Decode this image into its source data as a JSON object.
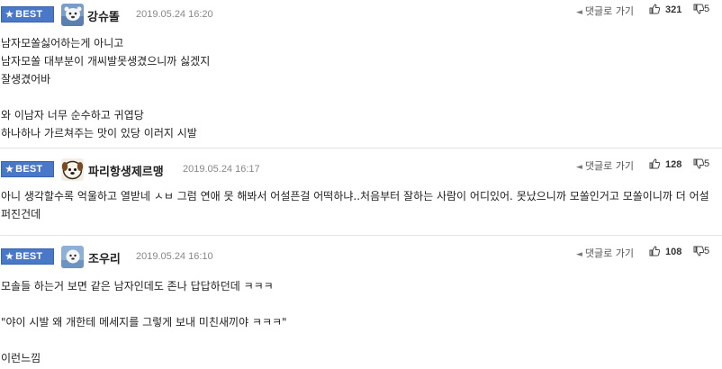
{
  "comments": [
    {
      "badge": "BEST",
      "nickname": "강슈똘",
      "date": "2019.05.24 16:20",
      "reply_label": "댓글로 가기",
      "likes": "321",
      "dislikes": "5",
      "lines": [
        "남자모쏠싫어하는게 아니고",
        "남자모쏠 대부분이 개씨발못생겼으니까 싫겠지",
        "잘생겼어바",
        "",
        "와 이남자 너무 순수하고 귀엽당",
        "하나하나 가르쳐주는 맛이 있당 이러지 시발"
      ]
    },
    {
      "badge": "BEST",
      "nickname": "파리항생제르맹",
      "date": "2019.05.24 16:17",
      "reply_label": "댓글로 가기",
      "likes": "128",
      "dislikes": "5",
      "text": "아니 생각할수록 억울하고 열받네 ㅅㅂ 그럼 연애 못 해봐서 어설픈걸 어떡하냐..처음부터 잘하는 사람이 어디있어. 못났으니까 모쏠인거고 모쏠이니까 더 어설퍼진건데"
    },
    {
      "badge": "BEST",
      "nickname": "조우리",
      "date": "2019.05.24 16:10",
      "reply_label": "댓글로 가기",
      "likes": "108",
      "dislikes": "5",
      "lines": [
        "모솔들 하는거 보면 같은 남자인데도 존나 답답하던데 ㅋㅋㅋ",
        "",
        "\"야이 시발 왜 개한테 메세지를 그렇게 보내 미친새끼야 ㅋㅋㅋ\"",
        "",
        "이런느낌"
      ]
    }
  ],
  "colors": {
    "badge": "#4a78c8",
    "divider": "#e3e3e3",
    "date": "#888888"
  },
  "icons": {
    "badge_star": "★",
    "reply_arrow": "◄",
    "like": "thumbs-up-icon",
    "dislike": "thumbs-down-icon"
  }
}
